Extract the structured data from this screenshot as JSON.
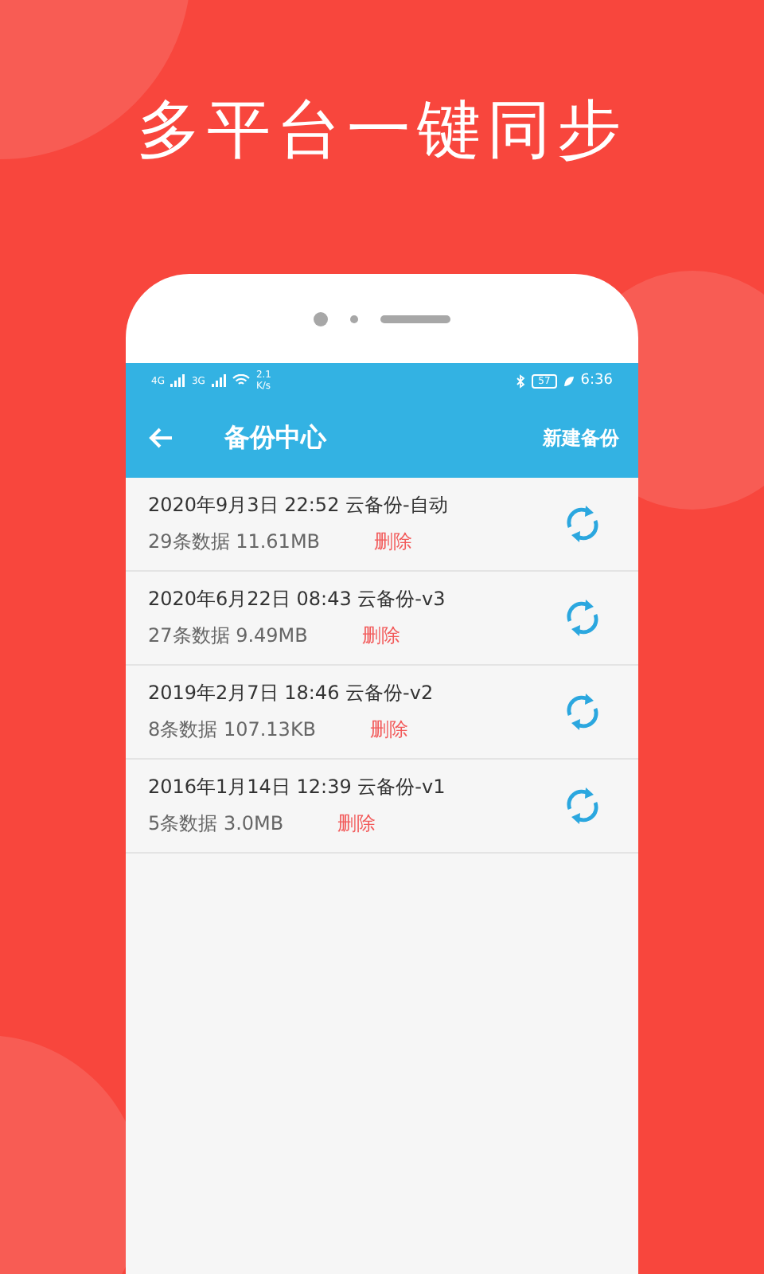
{
  "headline": "多平台一键同步",
  "status_bar": {
    "network_1": "4G",
    "network_2": "3G",
    "speed": "2.1",
    "speed_unit": "K/s",
    "battery": "57",
    "time": "6:36"
  },
  "app_bar": {
    "title": "备份中心",
    "action": "新建备份"
  },
  "backups": [
    {
      "title": "2020年9月3日 22:52 云备份-自动",
      "info": "29条数据 11.61MB",
      "delete": "删除"
    },
    {
      "title": "2020年6月22日 08:43 云备份-v3",
      "info": "27条数据 9.49MB",
      "delete": "删除"
    },
    {
      "title": "2019年2月7日 18:46 云备份-v2",
      "info": "8条数据 107.13KB",
      "delete": "删除"
    },
    {
      "title": "2016年1月14日 12:39 云备份-v1",
      "info": "5条数据 3.0MB",
      "delete": "删除"
    }
  ]
}
